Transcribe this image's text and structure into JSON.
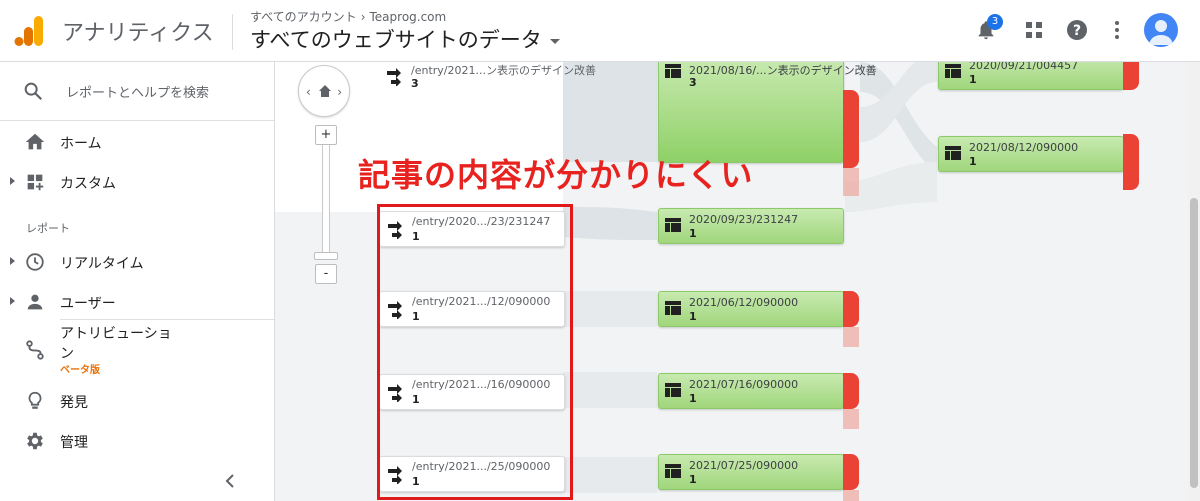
{
  "header": {
    "app_title": "アナリティクス",
    "breadcrumb": [
      "すべてのアカウント",
      "Teaprog.com"
    ],
    "view_title": "すべてのウェブサイトのデータ",
    "notification_count": "3"
  },
  "colors": {
    "accent": "#1a73e8",
    "logo_orange": "#f9ab00",
    "logo_dark": "#e37400",
    "node_green": "#a0d67c",
    "drop_red": "#ea4335",
    "annotation_red": "#e8231f"
  },
  "sidebar": {
    "search_placeholder": "レポートとヘルプを検索",
    "items": [
      {
        "label": "ホーム",
        "icon": "home-icon"
      },
      {
        "label": "カスタム",
        "icon": "dashboard-icon"
      },
      {
        "label": "リアルタイム",
        "icon": "clock-icon"
      },
      {
        "label": "ユーザー",
        "icon": "person-icon"
      },
      {
        "label": "アトリビューション",
        "icon": "attribution-icon"
      },
      {
        "label": "発見",
        "icon": "lightbulb-icon"
      },
      {
        "label": "管理",
        "icon": "gear-icon"
      }
    ],
    "attribution_label_line1": "アトリビューショ",
    "attribution_label_line2": "ン",
    "beta_label": "ベータ版",
    "section_label": "レポート"
  },
  "flow": {
    "annotation": "記事の内容が分かりにくい",
    "zoom_in": "+",
    "zoom_out": "-",
    "sources": [
      {
        "path": "/entry/2021...ン表示のデザイン改善",
        "count": "3"
      },
      {
        "path": "/entry/2020.../23/231247",
        "count": "1"
      },
      {
        "path": "/entry/2021.../12/090000",
        "count": "1"
      },
      {
        "path": "/entry/2021.../16/090000",
        "count": "1"
      },
      {
        "path": "/entry/2021.../25/090000",
        "count": "1"
      }
    ],
    "pages": [
      {
        "path": "2021/08/16/...ン表示のデザイン改善",
        "count": "3"
      },
      {
        "path": "2020/09/23/231247",
        "count": "1"
      },
      {
        "path": "2021/06/12/090000",
        "count": "1"
      },
      {
        "path": "2021/07/16/090000",
        "count": "1"
      },
      {
        "path": "2021/07/25/090000",
        "count": "1"
      }
    ],
    "next_pages": [
      {
        "path": "2020/09/21/004457",
        "count": "1"
      },
      {
        "path": "2021/08/12/090000",
        "count": "1"
      }
    ]
  }
}
